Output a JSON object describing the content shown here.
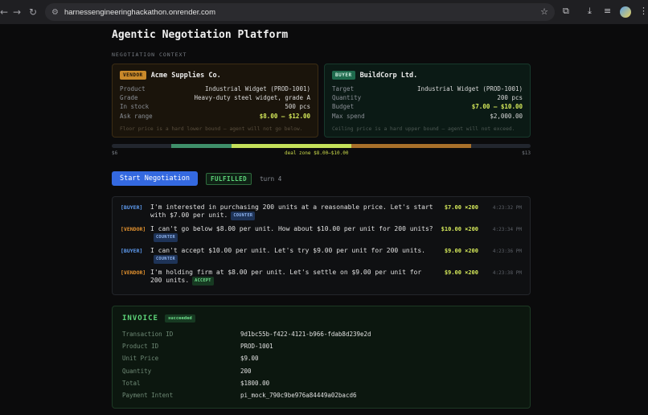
{
  "browser": {
    "url": "harnessengineeringhackathon.onrender.com"
  },
  "page": {
    "title": "Agentic Negotiation Platform",
    "section_label": "NEGOTIATION CONTEXT"
  },
  "vendor": {
    "badge": "VENDOR",
    "name": "Acme Supplies Co.",
    "rows": [
      {
        "k": "Product",
        "v": "Industrial Widget (PROD-1001)"
      },
      {
        "k": "Grade",
        "v": "Heavy-duty steel widget, grade A"
      },
      {
        "k": "In stock",
        "v": "500 pcs"
      },
      {
        "k": "Ask range",
        "v": "$8.00 – $12.00"
      }
    ],
    "note": "Floor price is a hard lower bound — agent will not go below."
  },
  "buyer": {
    "badge": "BUYER",
    "name": "BuildCorp Ltd.",
    "rows": [
      {
        "k": "Target",
        "v": "Industrial Widget (PROD-1001)"
      },
      {
        "k": "Quantity",
        "v": "200 pcs"
      },
      {
        "k": "Budget",
        "v": "$7.00 – $10.00"
      },
      {
        "k": "Max spend",
        "v": "$2,000.00"
      }
    ],
    "note": "Ceiling price is a hard upper bound — agent will not exceed."
  },
  "range_bar": {
    "min_label": "$6",
    "max_label": "$13",
    "zone_label": "deal zone $8.00–$10.00",
    "min": 6,
    "max": 13,
    "buyer_range": [
      7,
      10
    ],
    "vendor_range": [
      8,
      12
    ],
    "deal_zone": [
      8,
      10
    ],
    "colors": {
      "buyer": "#3f8f6a",
      "vendor": "#a8702a",
      "zone": "#c4e05a",
      "track": "#22262e"
    }
  },
  "controls": {
    "start_label": "Start Negotiation",
    "status": "FULFILLED",
    "turn": "turn 4"
  },
  "messages": [
    {
      "role": "buyer",
      "who": "[BUYER]",
      "text": "I'm interested in purchasing 200 units at a reasonable price. Let's start with $7.00 per unit.",
      "tag": "COUNTER",
      "price": "$7.00 ×200",
      "time": "4:23:32 PM"
    },
    {
      "role": "vendor",
      "who": "[VENDOR]",
      "text": "I can't go below $8.00 per unit. How about $10.00 per unit for 200 units?",
      "tag": "COUNTER",
      "price": "$10.00 ×200",
      "time": "4:23:34 PM"
    },
    {
      "role": "buyer",
      "who": "[BUYER]",
      "text": "I can't accept $10.00 per unit. Let's try $9.00 per unit for 200 units.",
      "tag": "COUNTER",
      "price": "$9.00 ×200",
      "time": "4:23:36 PM"
    },
    {
      "role": "vendor",
      "who": "[VENDOR]",
      "text": "I'm holding firm at $8.00 per unit. Let's settle on $9.00 per unit for 200 units.",
      "tag": "ACCEPT",
      "price": "$9.00 ×200",
      "time": "4:23:38 PM"
    }
  ],
  "invoice": {
    "title": "INVOICE",
    "status": "succeeded",
    "rows": [
      {
        "k": "Transaction ID",
        "v": "9d1bc55b-f422-4121-b966-fdab8d239e2d"
      },
      {
        "k": "Product ID",
        "v": "PROD-1001"
      },
      {
        "k": "Unit Price",
        "v": "$9.00"
      },
      {
        "k": "Quantity",
        "v": "200"
      },
      {
        "k": "Total",
        "v": "$1800.00"
      },
      {
        "k": "Payment Intent",
        "v": "pi_mock_790c9be976a84449a02bacd6"
      }
    ]
  }
}
